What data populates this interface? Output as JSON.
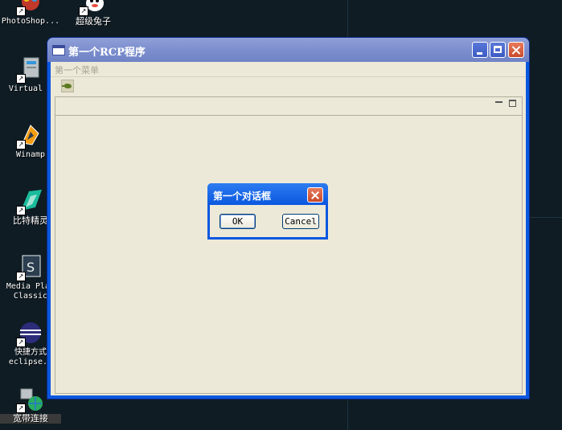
{
  "desktop": {
    "icons": [
      {
        "label": "PhotoShop..."
      },
      {
        "label": "超级兔子"
      },
      {
        "label": "Virtual P"
      },
      {
        "label": "Winamp"
      },
      {
        "label": "比特精灵"
      },
      {
        "label": "Media Play\nClassic"
      },
      {
        "label": "快捷方式\neclipse.e"
      },
      {
        "label": "宽带连接"
      }
    ]
  },
  "main_window": {
    "title": "第一个RCP程序",
    "menu": [
      "第一个菜单"
    ]
  },
  "dialog": {
    "title": "第一个对话框",
    "ok_label": "OK",
    "cancel_label": "Cancel"
  },
  "colors": {
    "desktop_bg": "#0f1c24",
    "title_active": "#0a58e0",
    "title_inactive": "#7e90cf",
    "client_bg": "#ece9d8"
  }
}
